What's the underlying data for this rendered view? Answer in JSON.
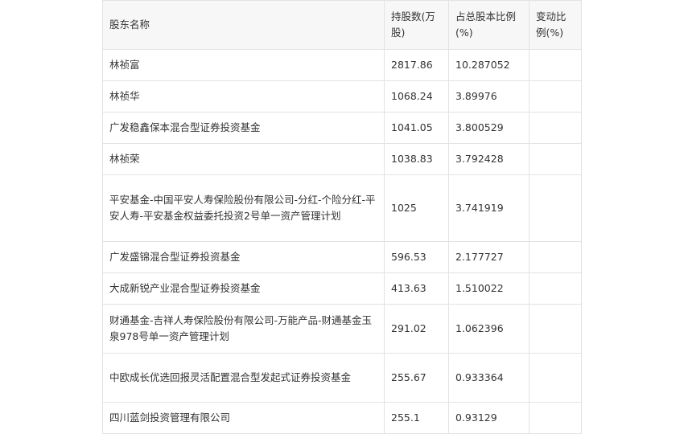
{
  "table": {
    "headers": {
      "name": "股东名称",
      "shares": "持股数(万股)",
      "ratio": "占总股本比例(%)",
      "change": "变动比例(%)"
    },
    "rows": [
      {
        "name": "林祯富",
        "shares": "2817.86",
        "ratio": "10.287052",
        "change": ""
      },
      {
        "name": "林祯华",
        "shares": "1068.24",
        "ratio": "3.89976",
        "change": ""
      },
      {
        "name": "广发稳鑫保本混合型证券投资基金",
        "shares": "1041.05",
        "ratio": "3.800529",
        "change": ""
      },
      {
        "name": "林祯荣",
        "shares": "1038.83",
        "ratio": "3.792428",
        "change": ""
      },
      {
        "name": "平安基金-中国平安人寿保险股份有限公司-分红-个险分红-平安人寿-平安基金权益委托投资2号单一资产管理计划",
        "shares": "1025",
        "ratio": "3.741919",
        "change": ""
      },
      {
        "name": "广发盛锦混合型证券投资基金",
        "shares": "596.53",
        "ratio": "2.177727",
        "change": ""
      },
      {
        "name": "大成新锐产业混合型证券投资基金",
        "shares": "413.63",
        "ratio": "1.510022",
        "change": ""
      },
      {
        "name": "财通基金-吉祥人寿保险股份有限公司-万能产品-财通基金玉泉978号单一资产管理计划",
        "shares": "291.02",
        "ratio": "1.062396",
        "change": ""
      },
      {
        "name": "中欧成长优选回报灵活配置混合型发起式证券投资基金",
        "shares": "255.67",
        "ratio": "0.933364",
        "change": ""
      },
      {
        "name": "四川蓝剑投资管理有限公司",
        "shares": "255.1",
        "ratio": "0.93129",
        "change": ""
      }
    ]
  }
}
